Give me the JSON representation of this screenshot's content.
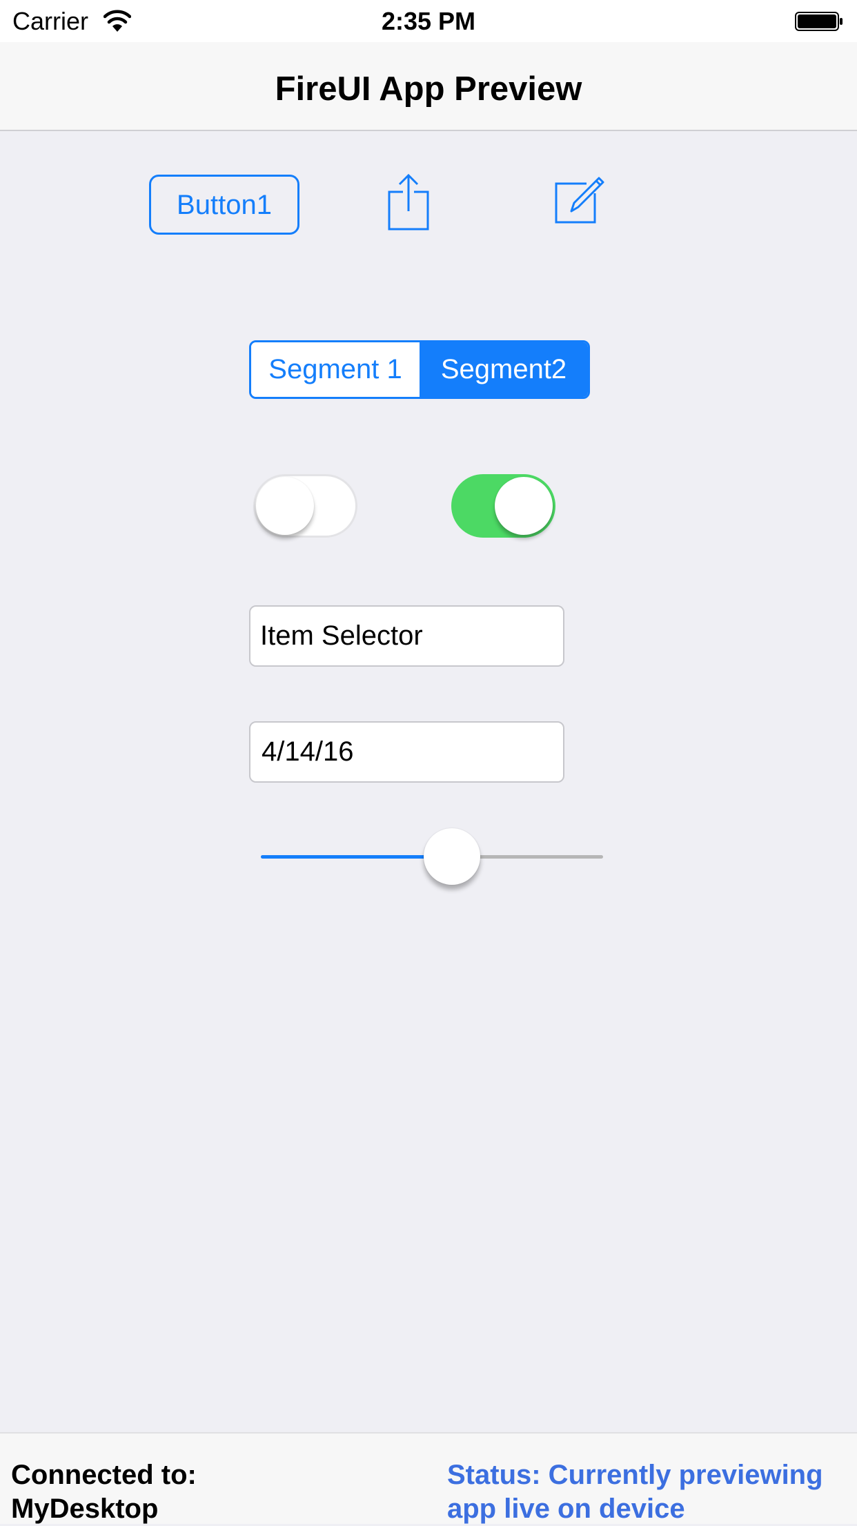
{
  "status_bar": {
    "carrier": "Carrier",
    "time": "2:35 PM",
    "wifi_icon": "wifi-icon",
    "battery_icon": "battery-icon"
  },
  "nav": {
    "title": "FireUI App Preview"
  },
  "toolbar": {
    "button1_label": "Button1",
    "share_icon": "share-icon",
    "compose_icon": "compose-icon"
  },
  "segmented": {
    "segments": [
      "Segment 1",
      "Segment2"
    ],
    "selected_index": 1
  },
  "switches": [
    {
      "on": false
    },
    {
      "on": true
    }
  ],
  "item_selector": {
    "value": "Item Selector"
  },
  "date_field": {
    "value": "4/14/16"
  },
  "slider": {
    "value": 0.57
  },
  "footer": {
    "connected_label": "Connected to:",
    "connected_value": "MyDesktop",
    "status_line1": "Status: Currently previewing",
    "status_line2": "app live on device"
  },
  "colors": {
    "accent": "#147EFB",
    "switch_on": "#4CD964",
    "background": "#EFEFF4",
    "status_text": "#3C6FE0"
  }
}
